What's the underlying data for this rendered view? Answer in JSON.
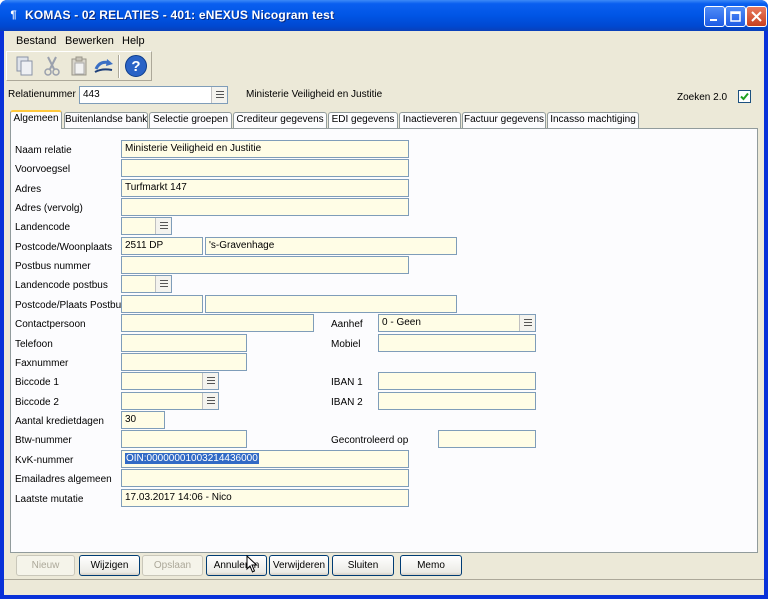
{
  "window": {
    "title": "KOMAS - 02 RELATIES - 401: eNEXUS Nicogram test",
    "app_icon": "komas-app-icon"
  },
  "menu": [
    "Bestand",
    "Bewerken",
    "Help"
  ],
  "toolbar": {
    "icons": [
      "copy-icon",
      "cut-icon",
      "paste-icon",
      "undo-icon",
      "help-icon"
    ]
  },
  "header": {
    "relatienummer_label": "Relatienummer",
    "relatienummer_value": "443",
    "relation_name": "Ministerie Veiligheid en Justitie",
    "zoeken_label": "Zoeken 2.0",
    "zoeken_checked": true
  },
  "tabs": [
    "Algemeen",
    "Buitenlandse bank",
    "Selectie groepen",
    "Crediteur gegevens",
    "EDI gegevens",
    "Inactieveren",
    "Factuur gegevens",
    "Incasso machtiging"
  ],
  "form": {
    "naam_relatie": {
      "label": "Naam relatie",
      "value": "Ministerie Veiligheid en Justitie"
    },
    "voorvoegsel": {
      "label": "Voorvoegsel",
      "value": ""
    },
    "adres": {
      "label": "Adres",
      "value": "Turfmarkt 147"
    },
    "adres_vervolg": {
      "label": "Adres (vervolg)",
      "value": ""
    },
    "landencode": {
      "label": "Landencode",
      "value": ""
    },
    "postcode_woonplaats": {
      "label": "Postcode/Woonplaats",
      "postcode": "2511 DP",
      "woonplaats": "'s-Gravenhage"
    },
    "postbus_nummer": {
      "label": "Postbus nummer",
      "value": ""
    },
    "landencode_postbus": {
      "label": "Landencode postbus",
      "value": ""
    },
    "postcode_plaats_postbus": {
      "label": "Postcode/Plaats Postbus",
      "postcode": "",
      "plaats": ""
    },
    "contactpersoon": {
      "label": "Contactpersoon",
      "value": ""
    },
    "aanhef": {
      "label": "Aanhef",
      "value": "0 - Geen"
    },
    "telefoon": {
      "label": "Telefoon",
      "value": ""
    },
    "mobiel": {
      "label": "Mobiel",
      "value": ""
    },
    "faxnummer": {
      "label": "Faxnummer",
      "value": ""
    },
    "biccode1": {
      "label": "Biccode 1",
      "value": ""
    },
    "iban1": {
      "label": "IBAN 1",
      "value": ""
    },
    "biccode2": {
      "label": "Biccode 2",
      "value": ""
    },
    "iban2": {
      "label": "IBAN 2",
      "value": ""
    },
    "kredietdagen": {
      "label": "Aantal kredietdagen",
      "value": "30"
    },
    "btw_nummer": {
      "label": "Btw-nummer",
      "value": ""
    },
    "gecontroleerd_op": {
      "label": "Gecontroleerd op",
      "value": ""
    },
    "kvk_nummer": {
      "label": "KvK-nummer",
      "value": "OIN:00000001003214436000"
    },
    "emailadres": {
      "label": "Emailadres algemeen",
      "value": ""
    },
    "laatste_mutatie": {
      "label": "Laatste mutatie",
      "value": "17.03.2017 14:06 - Nico"
    }
  },
  "buttons": {
    "nieuw": "Nieuw",
    "wijzigen": "Wijzigen",
    "opslaan": "Opslaan",
    "annuleren": "Annuleren",
    "verwijderen": "Verwijderen",
    "sluiten": "Sluiten",
    "memo": "Memo"
  },
  "colors": {
    "field_bg": "#fffde6",
    "panel_bg": "#fcfcfe",
    "window_bg": "#ece9d8",
    "titlebar": "#0055e5",
    "tab_accent": "#ffc83c",
    "highlight": "#316ac5"
  }
}
